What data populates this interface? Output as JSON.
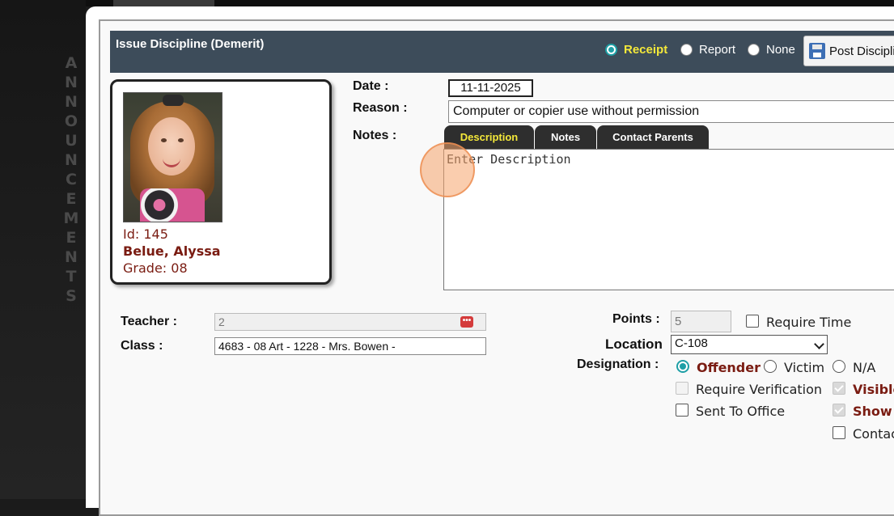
{
  "background": {
    "vertical_label": "ANNOUNCEMENTS"
  },
  "header": {
    "title": "Issue Discipline (Demerit)",
    "print_options": [
      {
        "label": "Receipt",
        "selected": true
      },
      {
        "label": "Report",
        "selected": false
      },
      {
        "label": "None",
        "selected": false
      }
    ],
    "post_button": "Post Disciplin",
    "post_icon": "floppy-disk-icon"
  },
  "student": {
    "id_label": "Id: 145",
    "name": "Belue, Alyssa",
    "grade_label": "Grade: 08"
  },
  "form": {
    "date_label": "Date :",
    "date_value": "11-11-2025",
    "reason_label": "Reason :",
    "reason_value": "Computer or copier use without permission",
    "notes_label": "Notes :",
    "tabs": [
      {
        "label": "Description",
        "active": true
      },
      {
        "label": "Notes",
        "active": false
      },
      {
        "label": "Contact Parents",
        "active": false
      }
    ],
    "notes_text": "Enter Description",
    "teacher_label": "Teacher :",
    "teacher_value": "2",
    "class_label": "Class :",
    "class_value": "4683 - 08 Art - 1228 - Mrs. Bowen -",
    "points_label": "Points :",
    "points_value": "5",
    "require_time_label": "Require Time",
    "location_label": "Location",
    "location_value": "C-108",
    "designation_label": "Designation :",
    "designations": [
      {
        "label": "Offender",
        "selected": true
      },
      {
        "label": "Victim",
        "selected": false
      },
      {
        "label": "N/A",
        "selected": false
      }
    ],
    "require_verification_label": "Require Verification",
    "sent_to_office_label": "Sent To Office",
    "visible_label": "Visible",
    "show_label": "Show I",
    "contact_label": "Contac"
  },
  "colors": {
    "header_bg": "#3d4c5a",
    "accent_yellow": "#f4e83a",
    "radio_teal": "#1e9fa6",
    "student_text": "#7a1c12"
  }
}
